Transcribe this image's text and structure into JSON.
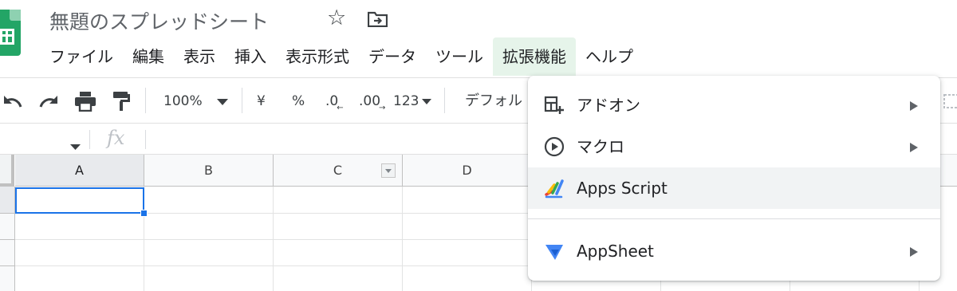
{
  "app": {
    "doc_title": "無題のスプレッドシート",
    "accent_color": "#1a73e8",
    "brand_color": "#23a566"
  },
  "menubar": {
    "items": [
      "ファイル",
      "編集",
      "表示",
      "挿入",
      "表示形式",
      "データ",
      "ツール",
      "拡張機能",
      "ヘルプ"
    ],
    "active_item": "拡張機能"
  },
  "toolbar": {
    "zoom": "100%",
    "currency": "¥",
    "percent": "%",
    "decrease_decimal": ".0",
    "increase_decimal": ".00",
    "more_formats": "123",
    "font": "デフォル",
    "icons": [
      "undo-icon",
      "redo-icon",
      "print-icon",
      "paint-format-icon"
    ]
  },
  "formula_bar": {
    "fx_label": "fx"
  },
  "grid": {
    "columns": [
      "A",
      "B",
      "C",
      "D"
    ],
    "selected_cell": "A1",
    "filter_column": "C"
  },
  "extensions_menu": {
    "items": [
      {
        "label": "アドオン",
        "icon": "addons-icon",
        "submenu": true
      },
      {
        "label": "マクロ",
        "icon": "macro-play-icon",
        "submenu": true
      },
      {
        "label": "Apps Script",
        "icon": "apps-script-icon",
        "submenu": false,
        "highlighted": true
      },
      {
        "label": "AppSheet",
        "icon": "appsheet-icon",
        "submenu": true
      }
    ]
  }
}
